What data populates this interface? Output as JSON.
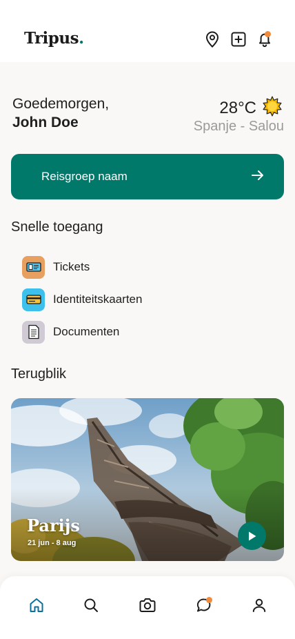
{
  "header": {
    "logo_text": "Tripus",
    "logo_dot": ".",
    "icons": [
      "map-pin-icon",
      "add-square-icon",
      "bell-icon"
    ],
    "notification_color": "#f08a3c"
  },
  "greeting": {
    "salutation": "Goedemorgen,",
    "name": "John Doe"
  },
  "weather": {
    "temperature": "28°C",
    "icon": "sun-icon",
    "location": "Spanje - Salou"
  },
  "group_button": {
    "label": "Reisgroep naam",
    "color": "#00796b"
  },
  "quick_access": {
    "title": "Snelle toegang",
    "items": [
      {
        "label": "Tickets",
        "icon": "ticket-icon",
        "color": "#e8a060"
      },
      {
        "label": "Identiteitskaarten",
        "icon": "id-card-icon",
        "color": "#3ec0ec"
      },
      {
        "label": "Documenten",
        "icon": "document-icon",
        "color": "#cfcad3"
      }
    ]
  },
  "recap": {
    "title": "Terugblik",
    "card_title": "Parijs",
    "card_dates": "21 jun - 8 aug"
  },
  "bottom_nav": {
    "items": [
      "home-icon",
      "search-icon",
      "camera-icon",
      "chat-icon",
      "profile-icon"
    ],
    "active": "home-icon"
  }
}
